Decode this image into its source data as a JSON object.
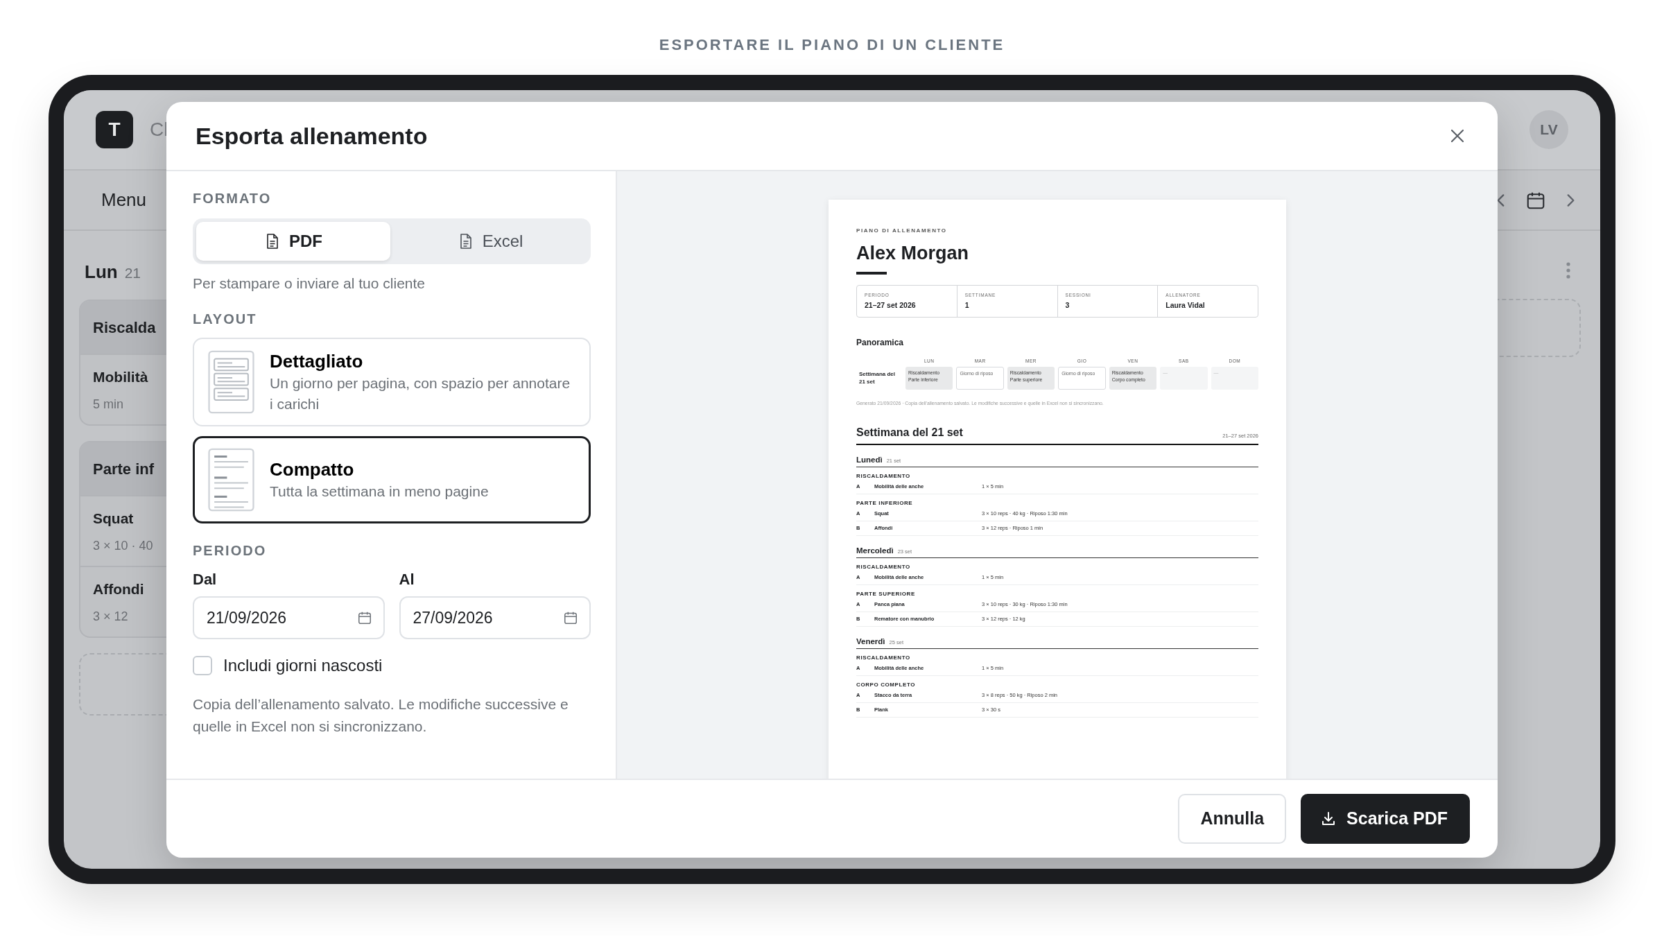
{
  "caption": "ESPORTARE IL PIANO DI UN CLIENTE",
  "app": {
    "logo": "T",
    "title": "Cl",
    "avatar": "LV",
    "menu": "Menu",
    "day": {
      "name": "Lun",
      "date": "21"
    },
    "groups": [
      {
        "title": "Riscalda",
        "items": [
          {
            "name": "Mobilità",
            "detail": "5 min"
          }
        ]
      },
      {
        "title": "Parte inf",
        "items": [
          {
            "name": "Squat",
            "detail": "3 × 10 · 40"
          },
          {
            "name": "Affondi",
            "detail": "3 × 12"
          }
        ]
      }
    ]
  },
  "dialog": {
    "title": "Esporta allenamento",
    "format": {
      "label": "FORMATO",
      "options": [
        {
          "label": "PDF",
          "selected": true
        },
        {
          "label": "Excel",
          "selected": false
        }
      ],
      "hint": "Per stampare o inviare al tuo cliente"
    },
    "layout": {
      "label": "LAYOUT",
      "options": [
        {
          "kind": "detailed",
          "title": "Dettagliato",
          "description": "Un giorno per pagina, con spazio per annotare i carichi",
          "selected": false
        },
        {
          "kind": "compact",
          "title": "Compatto",
          "description": "Tutta la settimana in meno pagine",
          "selected": true
        }
      ]
    },
    "period": {
      "label": "PERIODO",
      "from": {
        "label": "Dal",
        "value": "21/09/2026"
      },
      "to": {
        "label": "Al",
        "value": "27/09/2026"
      }
    },
    "include_hidden": {
      "label": "Includi giorni nascosti",
      "checked": false
    },
    "note": "Copia dell’allenamento salvato. Le modifiche successive e quelle in Excel non si sincronizzano.",
    "buttons": [
      {
        "label": "Annulla",
        "kind": "secondary"
      },
      {
        "label": "Scarica PDF",
        "kind": "primary"
      }
    ]
  },
  "preview": {
    "eyebrow": "PIANO DI ALLENAMENTO",
    "name": "Alex Morgan",
    "stats": [
      {
        "label": "PERIODO",
        "value": "21–27 set 2026"
      },
      {
        "label": "SETTIMANE",
        "value": "1"
      },
      {
        "label": "SESSIONI",
        "value": "3"
      },
      {
        "label": "ALLENATORE",
        "value": "Laura Vidal"
      }
    ],
    "overview": {
      "title": "Panoramica",
      "days": [
        "LUN",
        "MAR",
        "MER",
        "GIO",
        "VEN",
        "SAB",
        "DOM"
      ],
      "row_label": "Settimana del 21 set",
      "cells": [
        {
          "kind": "session",
          "lines": [
            "Riscaldamento",
            "Parte inferiore"
          ]
        },
        {
          "kind": "rest",
          "lines": [
            "Giorno di riposo"
          ]
        },
        {
          "kind": "session",
          "lines": [
            "Riscaldamento",
            "Parte superiore"
          ]
        },
        {
          "kind": "rest",
          "lines": [
            "Giorno di riposo"
          ]
        },
        {
          "kind": "session",
          "lines": [
            "Riscaldamento",
            "Corpo completo"
          ]
        },
        {
          "kind": "empty",
          "lines": [
            "—"
          ]
        },
        {
          "kind": "empty",
          "lines": [
            "—"
          ]
        }
      ]
    },
    "footnote": "Generato 21/09/2026 · Copia dell’allenamento salvato. Le modifiche successive e quelle in Excel non si sincronizzano.",
    "week": {
      "title": "Settimana del 21 set",
      "range": "21–27 set 2026",
      "days": [
        {
          "name": "Lunedì",
          "date": "21 set",
          "blocks": [
            {
              "title": "RISCALDAMENTO",
              "exercises": [
                {
                  "letter": "A",
                  "name": "Mobilità delle anche",
                  "detail": "1 × 5 min"
                }
              ]
            },
            {
              "title": "PARTE INFERIORE",
              "exercises": [
                {
                  "letter": "A",
                  "name": "Squat",
                  "detail": "3 × 10 reps · 40 kg · Riposo 1:30 min"
                },
                {
                  "letter": "B",
                  "name": "Affondi",
                  "detail": "3 × 12 reps · Riposo 1 min"
                }
              ]
            }
          ]
        },
        {
          "name": "Mercoledì",
          "date": "23 set",
          "blocks": [
            {
              "title": "RISCALDAMENTO",
              "exercises": [
                {
                  "letter": "A",
                  "name": "Mobilità delle anche",
                  "detail": "1 × 5 min"
                }
              ]
            },
            {
              "title": "PARTE SUPERIORE",
              "exercises": [
                {
                  "letter": "A",
                  "name": "Panca piana",
                  "detail": "3 × 10 reps · 30 kg · Riposo 1:30 min"
                },
                {
                  "letter": "B",
                  "name": "Rematore con manubrio",
                  "detail": "3 × 12 reps · 12 kg"
                }
              ]
            }
          ]
        },
        {
          "name": "Venerdì",
          "date": "25 set",
          "blocks": [
            {
              "title": "RISCALDAMENTO",
              "exercises": [
                {
                  "letter": "A",
                  "name": "Mobilità delle anche",
                  "detail": "1 × 5 min"
                }
              ]
            },
            {
              "title": "CORPO COMPLETO",
              "exercises": [
                {
                  "letter": "A",
                  "name": "Stacco da terra",
                  "detail": "3 × 8 reps · 50 kg · Riposo 2 min"
                },
                {
                  "letter": "B",
                  "name": "Plank",
                  "detail": "3 × 30 s"
                }
              ]
            }
          ]
        }
      ]
    }
  }
}
